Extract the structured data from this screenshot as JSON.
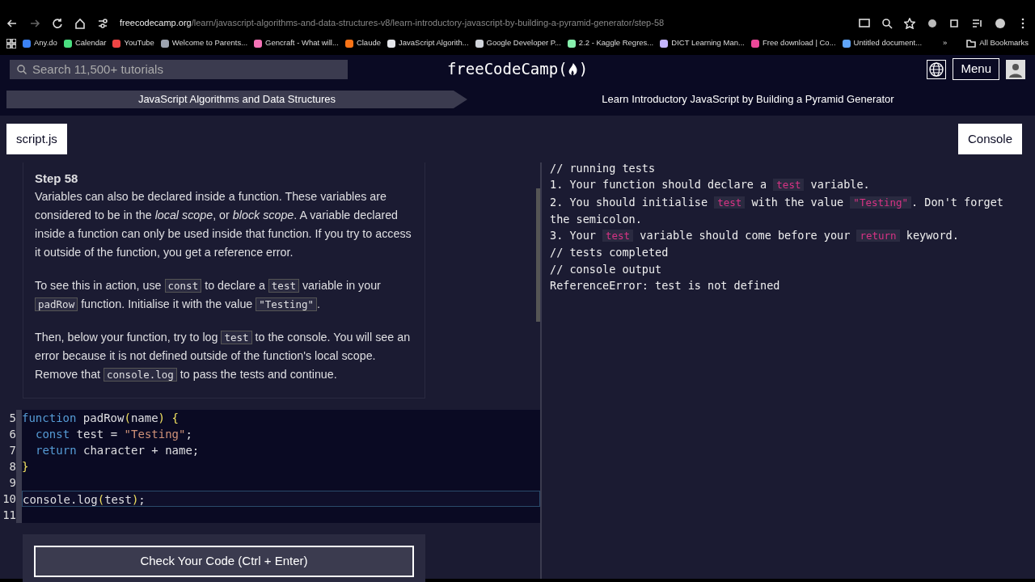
{
  "browser": {
    "url_host": "freecodecamp.org",
    "url_path": "/learn/javascript-algorithms-and-data-structures-v8/learn-introductory-javascript-by-building-a-pyramid-generator/step-58",
    "bookmarks": [
      {
        "label": "Any.do",
        "color": "#3b82f6"
      },
      {
        "label": "Calendar",
        "color": "#4ade80"
      },
      {
        "label": "YouTube",
        "color": "#ef4444"
      },
      {
        "label": "Welcome to Parents...",
        "color": "#9ca3af"
      },
      {
        "label": "Gencraft - What will...",
        "color": "#f472b6"
      },
      {
        "label": "Claude",
        "color": "#f97316"
      },
      {
        "label": "JavaScript Algorith...",
        "color": "#e5e7eb"
      },
      {
        "label": "Google Developer P...",
        "color": "#d1d5db"
      },
      {
        "label": "2.2 - Kaggle Regres...",
        "color": "#86efac"
      },
      {
        "label": "DICT Learning Man...",
        "color": "#c4b5fd"
      },
      {
        "label": "Free download | Co...",
        "color": "#ec4899"
      },
      {
        "label": "Untitled document...",
        "color": "#60a5fa"
      }
    ],
    "overflow": "»",
    "all_bookmarks": "All Bookmarks"
  },
  "navbar": {
    "search_placeholder": "Search 11,500+ tutorials",
    "logo": "freeCodeCamp(",
    "logo_end": ")",
    "menu": "Menu"
  },
  "breadcrumb": [
    "JavaScript Algorithms and Data Structures",
    "Learn Introductory JavaScript by Building a Pyramid Generator"
  ],
  "tabs": [
    {
      "label": "script.js"
    },
    {
      "label": "Console"
    }
  ],
  "description": {
    "title": "Step 58",
    "paragraphs": [
      [
        {
          "kind": "text",
          "text": "Variables can also be declared inside a function. These variables are considered to be in the *local scope*, or *block scope*. A variable declared inside a function can only be used inside that function. If you try to access it outside of the function, you get a reference error."
        }
      ],
      [
        {
          "kind": "text",
          "text": "To see this in action, use "
        },
        {
          "kind": "code",
          "text": "const"
        },
        {
          "kind": "text",
          "text": " to declare a "
        },
        {
          "kind": "code",
          "text": "test"
        },
        {
          "kind": "text",
          "text": " variable in your "
        },
        {
          "kind": "code",
          "text": "padRow"
        },
        {
          "kind": "text",
          "text": " function. Initialise it with the value "
        },
        {
          "kind": "code",
          "text": "\"Testing\""
        },
        {
          "kind": "text",
          "text": "."
        }
      ],
      [
        {
          "kind": "text",
          "text": "Then, below your function, try to log "
        },
        {
          "kind": "code",
          "text": "test"
        },
        {
          "kind": "text",
          "text": " to the console. You will see an error because it is not defined outside of the function's local scope. Remove that "
        },
        {
          "kind": "code",
          "text": "console.log"
        },
        {
          "kind": "text",
          "text": " to pass the tests and continue."
        }
      ]
    ]
  },
  "editor": {
    "lines": [
      {
        "number": "5",
        "active": false,
        "indented": false,
        "tokens": [
          {
            "kind": "keyword",
            "text": "function"
          },
          {
            "kind": "plain",
            "text": " padRow"
          },
          {
            "kind": "paren",
            "text": "("
          },
          {
            "kind": "plain",
            "text": "name"
          },
          {
            "kind": "paren",
            "text": ")"
          },
          {
            "kind": "paren",
            "text": " {"
          }
        ]
      },
      {
        "number": "6",
        "active": false,
        "indented": true,
        "tokens": [
          {
            "kind": "keyword",
            "text": "const"
          },
          {
            "kind": "plain",
            "text": " test = "
          },
          {
            "kind": "string",
            "text": "\"Testing\""
          },
          {
            "kind": "plain",
            "text": ";"
          }
        ]
      },
      {
        "number": "7",
        "active": false,
        "indented": true,
        "tokens": [
          {
            "kind": "keyword",
            "text": "return"
          },
          {
            "kind": "plain",
            "text": " character + name;"
          }
        ]
      },
      {
        "number": "8",
        "active": false,
        "indented": false,
        "tokens": [
          {
            "kind": "paren",
            "text": "}"
          }
        ]
      },
      {
        "number": "9",
        "active": false
      },
      {
        "number": "10",
        "active": true,
        "indented": false,
        "tokens": [
          {
            "kind": "plain",
            "text": "console.log"
          },
          {
            "kind": "paren",
            "text": "("
          },
          {
            "kind": "plain",
            "text": "test"
          },
          {
            "kind": "paren",
            "text": ")"
          },
          {
            "kind": "plain",
            "text": ";"
          }
        ]
      },
      {
        "number": "11",
        "active": false
      }
    ]
  },
  "check_button": "Check Your Code (Ctrl + Enter)",
  "console": [
    [
      {
        "kind": "text",
        "text": "// running tests"
      }
    ],
    [
      {
        "kind": "text",
        "text": "1. Your function should declare a "
      },
      {
        "kind": "code",
        "text": "test"
      },
      {
        "kind": "text",
        "text": " variable."
      }
    ],
    [
      {
        "kind": "text",
        "text": "2. You should initialise "
      },
      {
        "kind": "code",
        "text": "test"
      },
      {
        "kind": "text",
        "text": " with the value "
      },
      {
        "kind": "code",
        "text": "\"Testing\""
      },
      {
        "kind": "text",
        "text": ". Don't forget the semicolon."
      }
    ],
    [
      {
        "kind": "text",
        "text": "3. Your "
      },
      {
        "kind": "code",
        "text": "test"
      },
      {
        "kind": "text",
        "text": " variable should come before your "
      },
      {
        "kind": "code",
        "text": "return"
      },
      {
        "kind": "text",
        "text": " keyword."
      }
    ],
    [
      {
        "kind": "text",
        "text": "// tests completed"
      }
    ],
    [
      {
        "kind": "text",
        "text": "// console output"
      }
    ],
    [
      {
        "kind": "text",
        "text": "ReferenceError: test is not defined"
      }
    ]
  ]
}
